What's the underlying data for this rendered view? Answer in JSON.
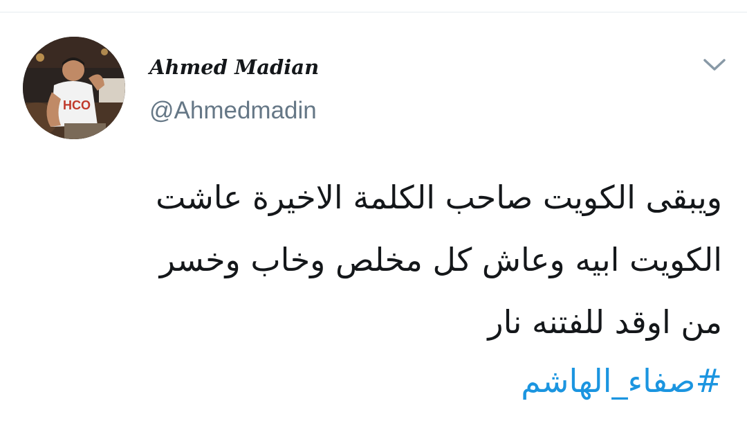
{
  "tweet": {
    "author": {
      "display_name": "Ahmed Madian",
      "handle": "@Ahmedmadin"
    },
    "menu_icon": "chevron-down-icon",
    "text_lines": [
      "ويبقى الكويت صاحب الكلمة الاخيرة عاشت",
      "الكويت ابيه وعاش كل مخلص وخاب وخسر",
      "من اوقد للفتنه نار"
    ],
    "hashtag": "#صفاء_الهاشم"
  },
  "colors": {
    "text": "#14171a",
    "secondary_text": "#657786",
    "link": "#1b95e0",
    "divider": "#e6ecf0",
    "chevron": "#8899a6"
  }
}
